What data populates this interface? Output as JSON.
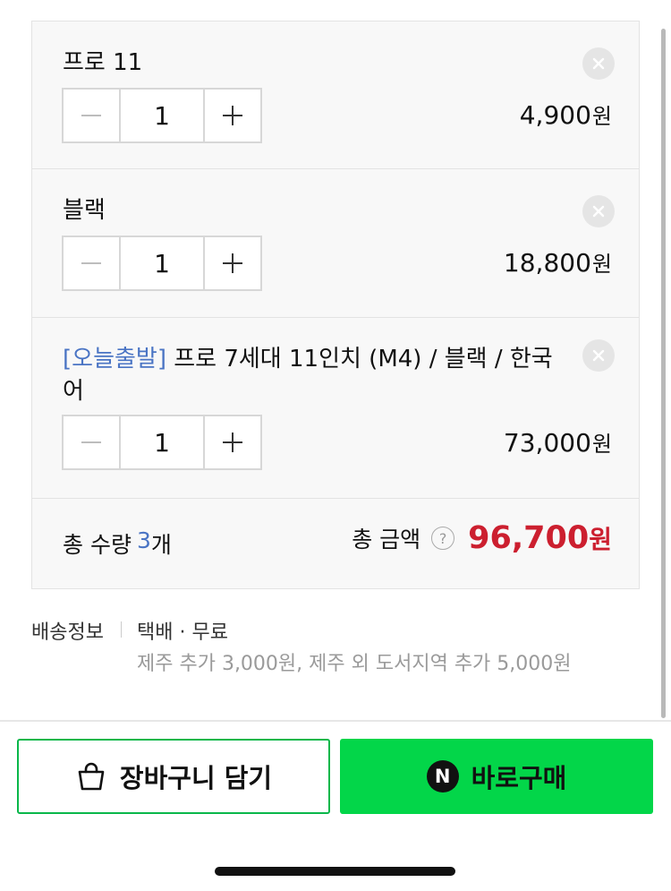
{
  "options": [
    {
      "name": "프로 11",
      "tag": "",
      "quantity": "1",
      "price": "4,900",
      "currency": "원",
      "icon": "close-icon"
    },
    {
      "name": "블랙",
      "tag": "",
      "quantity": "1",
      "price": "18,800",
      "currency": "원",
      "icon": "close-icon"
    },
    {
      "name": "프로 7세대 11인치 (M4) / 블랙 / 한국어",
      "tag": "[오늘출발]",
      "quantity": "1",
      "price": "73,000",
      "currency": "원",
      "icon": "close-icon"
    }
  ],
  "summary": {
    "qty_label": "총 수량",
    "qty_value": "3",
    "qty_unit": "개",
    "amount_label": "총 금액",
    "help_icon": "?",
    "amount_value": "96,700",
    "currency": "원"
  },
  "shipping": {
    "label": "배송정보",
    "method": "택배 · 무료",
    "extra": "제주 추가 3,000원, 제주 외 도서지역 추가 5,000원"
  },
  "actions": {
    "cart_label": "장바구니 담기",
    "buy_label": "바로구매",
    "npay_glyph": "N"
  },
  "colors": {
    "accent_green": "#03d649",
    "price_red": "#cc1f2f",
    "tag_blue": "#4a74c4"
  }
}
